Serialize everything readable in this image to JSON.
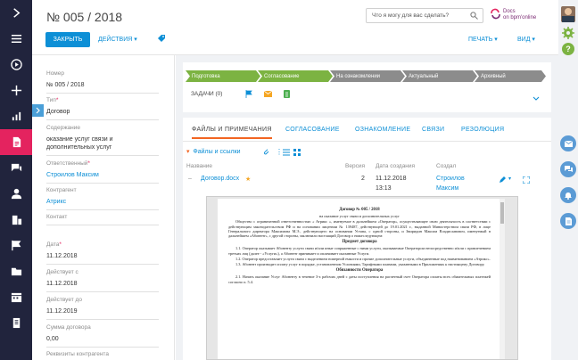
{
  "header": {
    "title": "№ 005 / 2018",
    "search_placeholder": "Что я могу для вас сделать?",
    "logo_text_1": "Docs",
    "logo_text_2": "on bpm'online",
    "close_label": "ЗАКРЫТЬ",
    "actions_label": "ДЕЙСТВИЯ ▾",
    "print_label": "ПЕЧАТЬ ▾",
    "view_label": "ВИД ▾"
  },
  "left_nav": {
    "icons": [
      "collapse-icon",
      "menu-icon",
      "play-icon",
      "plus-icon",
      "chart-icon",
      "document-icon",
      "chat-icon",
      "user-icon",
      "building-icon",
      "flag-icon",
      "folder-icon",
      "calendar-icon",
      "report-icon"
    ],
    "active": "document-icon",
    "active_color": "#e4235f",
    "bg_color": "#21243d"
  },
  "fields": [
    {
      "label": "Номер",
      "value": "№ 005 / 2018",
      "required": false,
      "link": false
    },
    {
      "label": "Тип",
      "value": "Договор",
      "required": true,
      "link": false
    },
    {
      "label": "Содержание",
      "value": "оказание услуг связи и дополнительных услуг",
      "required": false,
      "link": false
    },
    {
      "label": "Ответственный",
      "value": "Строилов Максим",
      "required": true,
      "link": true
    },
    {
      "label": "Контрагент",
      "value": "Атрикс",
      "required": false,
      "link": true
    },
    {
      "label": "Контакт",
      "value": "",
      "required": false,
      "link": false
    },
    {
      "label": "Дата",
      "value": "11.12.2018",
      "required": true,
      "link": false
    },
    {
      "label": "Действует с",
      "value": "11.12.2018",
      "required": false,
      "link": false
    },
    {
      "label": "Действует до",
      "value": "11.12.2019",
      "required": false,
      "link": false
    },
    {
      "label": "Сумма договора",
      "value": "0,00",
      "required": false,
      "link": false
    },
    {
      "label": "Реквизиты контрагента",
      "value": "",
      "required": false,
      "link": false
    }
  ],
  "stages": [
    {
      "label": "Подготовка",
      "state": "done"
    },
    {
      "label": "Согласование",
      "state": "done"
    },
    {
      "label": "На ознакомлении",
      "state": "pending"
    },
    {
      "label": "Актуальный",
      "state": "pending"
    },
    {
      "label": "Архивный",
      "state": "pending"
    }
  ],
  "tasks_label": "ЗАДАЧИ (0)",
  "tabs": [
    {
      "label": "ФАЙЛЫ И ПРИМЕЧАНИЯ",
      "active": true
    },
    {
      "label": "СОГЛАСОВАНИЕ",
      "active": false
    },
    {
      "label": "ОЗНАКОМЛЕНИЕ",
      "active": false
    },
    {
      "label": "СВЯЗИ",
      "active": false
    },
    {
      "label": "РЕЗОЛЮЦИЯ",
      "active": false
    }
  ],
  "files": {
    "section_label": "Файлы и ссылки",
    "columns": {
      "name": "Название",
      "version": "Версия",
      "created": "Дата создания",
      "author": "Создал"
    },
    "row": {
      "name": "Договор.docx",
      "version": "2",
      "date": "11.12.2018",
      "time": "13:13",
      "author_1": "Строилов",
      "author_2": "Максим"
    }
  },
  "document": {
    "title": "Договор № 005 / 2018",
    "subtitle": "на оказание услуг связи и дополнительных услуг",
    "p1": "Общество с ограниченной ответственностью « Атрикс », именуемое в дальнейшем «Оператор», осуществляющее свою деятельность в соответствии с действующим законодательством РФ и на основании лицензии № 139487, действующей до 19.01.2021 г., выданной Министерством связи РФ, в лице Генерального директора Максимова М.Э., действующего на основании Устава, с одной стороны, и Звиридин Максим Владиславович, именуемый в дальнейшем «Абонент», с другой стороны, заключили настоящий Договор о нижеследующем:",
    "h1": "Предмет договора",
    "p2": "1.1. Оператор оказывает Абоненту услуги связи и/или иные сопряженные с ними услуги, оказываемые Оператором непосредственно и/или с привлечением третьих лиц (далее - «Услуги»), а Абонент принимает и оплачивает оказанные Услуги.",
    "p3": "1.2. Оператор предоставляет услуги связи с выделением номерной емкости и прочие дополнительные услуги, объединенные под наименованием «Атрикс».",
    "p4": "1.3. Абонент производит оплату услуг в порядке, установленном Условиями, Тарифными планами, указанными в Приложениях к настоящему Договору.",
    "h2": "Обязанности Оператора",
    "p5": "2.1. Начать оказание Услуг Абоненту в течение 3-х рабочих дней с даты поступления на расчетный счет Оператора оплаты всех обязательных платежей согласно п. 5.4."
  },
  "right_nav": {
    "icons": [
      "mail-icon",
      "chat-icon",
      "bell-icon",
      "doc-icon"
    ],
    "accent_color": "#5b9bd5"
  }
}
